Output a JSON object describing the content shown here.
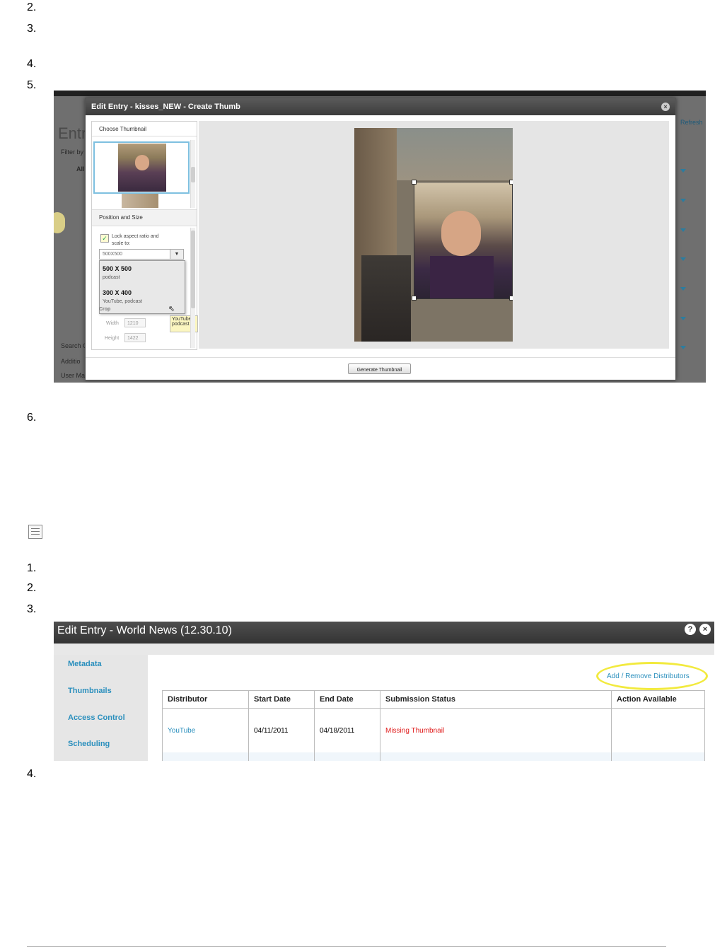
{
  "steps_top": [
    "2.",
    "3.",
    "4.",
    "5.",
    "6."
  ],
  "steps_bottom": [
    "1.",
    "2.",
    "3.",
    "4."
  ],
  "screenshot1": {
    "modal_title": "Edit Entry - kisses_NEW - Create Thumb",
    "background_title": "Entri",
    "background_refresh": "Refresh",
    "background_filter": "Filter by",
    "background_all": "All",
    "background_search": "Search Ca",
    "background_additional": "Additio",
    "background_user": "User Ma",
    "choose_thumbnail": "Choose Thumbnail",
    "position_and_size": "Position and Size",
    "lock_aspect": "Lock aspect ratio and",
    "scale_to": "scale to:",
    "select_value": "500X500",
    "options": [
      {
        "size": "500 X 500",
        "tags": "podcast"
      },
      {
        "size": "300 X 400",
        "tags": "YouTube, podcast"
      }
    ],
    "tooltip_line1": "YouTube",
    "tooltip_line2": "podcast",
    "crop_label": "Crop",
    "width_label": "Width",
    "width_value": "1210",
    "height_label": "Height",
    "height_value": "1422",
    "generate_button": "Generate Thumbnail"
  },
  "screenshot2": {
    "title": "Edit Entry - World News (12.30.10)",
    "help_icon": "?",
    "sidebar": [
      "Metadata",
      "Thumbnails",
      "Access Control",
      "Scheduling"
    ],
    "add_remove": "Add / Remove Distributors",
    "columns": [
      "Distributor",
      "Start Date",
      "End Date",
      "Submission Status",
      "Action Available"
    ],
    "rows": [
      {
        "distributor": "YouTube",
        "start": "04/11/2011",
        "end": "04/18/2011",
        "status": "Missing Thumbnail",
        "action": ""
      }
    ],
    "colors": {
      "link": "#2a8fbd",
      "error": "#e01c1c",
      "highlight": "#f2ea3e"
    }
  }
}
